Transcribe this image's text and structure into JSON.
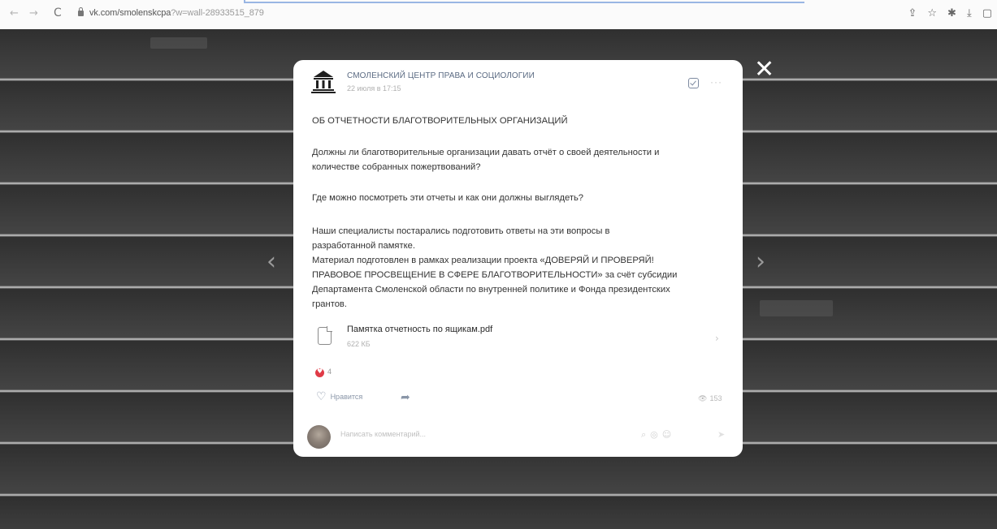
{
  "browser": {
    "url": "vk.com/smolenskcpa?w=wall-28933515_879",
    "url_prefix": "vk.com/smolenskcpa",
    "url_suffix": "?w=wall-28933515_879",
    "back_icon": "←",
    "forward_icon": "→",
    "reload_icon": "C"
  },
  "post": {
    "author": "СМОЛЕНСКИЙ ЦЕНТР ПРАВА И СОЦИОЛОГИИ",
    "date": "22 июля в 17:15",
    "lines": [
      "ОБ ОТЧЕТНОСТИ БЛАГОТВОРИТЕЛЬНЫХ ОРГАНИЗАЦИЙ",
      "Должны ли благотворительные организации давать отчёт о своей деятельности и",
      "количестве собранных пожертвований?",
      "Где можно посмотреть эти отчеты и как они должны выглядеть?",
      "Наши специалисты постарались подготовить ответы на эти вопросы в",
      "разработанной памятке.",
      "Материал подготовлен в рамках реализации проекта «ДОВЕРЯЙ И ПРОВЕРЯЙ!",
      "ПРАВОВОЕ ПРОСВЕЩЕНИЕ В СФЕРЕ БЛАГОТВОРИТЕЛЬНОСТИ» за счёт субсидии",
      "Департамента Смоленской области по внутренней политике и Фонда президентских",
      "грантов."
    ],
    "attachment": {
      "name": "Памятка отчетность по ящикам.pdf",
      "size": "622 КБ"
    },
    "reactions_count": "4",
    "like_label": "Нравится",
    "views": "153",
    "comment_placeholder": "Написать комментарий..."
  },
  "icons": {
    "close": "✕",
    "prev": "‹",
    "next": "›"
  }
}
